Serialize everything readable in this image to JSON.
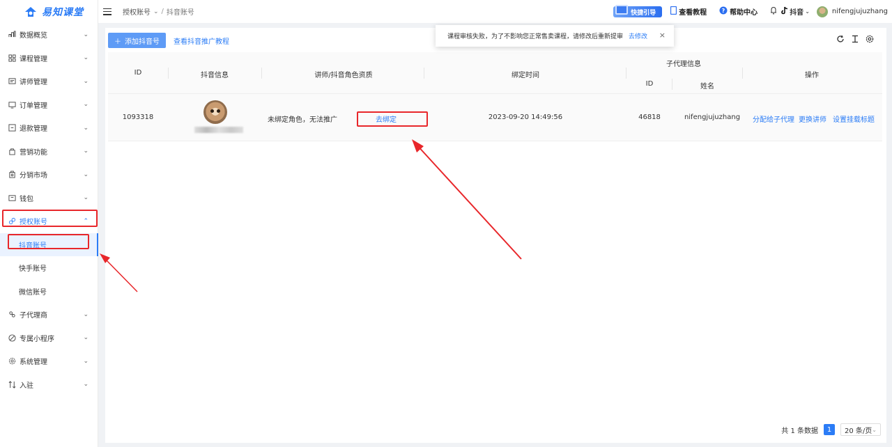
{
  "app": {
    "logo_text": "易知课堂"
  },
  "header": {
    "breadcrumb": {
      "parent": "授权账号",
      "separator": "/",
      "current": "抖音账号"
    },
    "quick_guide": "快捷引导",
    "tutorial": "查看教程",
    "help_center": "帮助中心",
    "platform": "抖音",
    "username": "nifengjujuzhang"
  },
  "sidebar": {
    "items": [
      {
        "label": "数据概览",
        "icon": "dashboard-icon"
      },
      {
        "label": "课程管理",
        "icon": "grid-icon"
      },
      {
        "label": "讲师管理",
        "icon": "teacher-icon"
      },
      {
        "label": "订单管理",
        "icon": "order-icon"
      },
      {
        "label": "退款管理",
        "icon": "refund-icon"
      },
      {
        "label": "营销功能",
        "icon": "marketing-icon"
      },
      {
        "label": "分销市场",
        "icon": "market-icon"
      },
      {
        "label": "钱包",
        "icon": "wallet-icon"
      },
      {
        "label": "授权账号",
        "icon": "link-icon"
      },
      {
        "label": "子代理商",
        "icon": "agent-icon"
      },
      {
        "label": "专属小程序",
        "icon": "miniapp-icon"
      },
      {
        "label": "系统管理",
        "icon": "settings-icon"
      },
      {
        "label": "入驻",
        "icon": "join-icon"
      }
    ],
    "sub_items": [
      {
        "label": "抖音账号"
      },
      {
        "label": "快手账号"
      },
      {
        "label": "微信账号"
      }
    ]
  },
  "toolbar": {
    "add_button": "添加抖音号",
    "tutorial_link": "查看抖音推广教程"
  },
  "notice": {
    "message": "课程审核失败，为了不影响您正常售卖课程，请修改后重新提审",
    "action": "去修改",
    "close": "×"
  },
  "table": {
    "headers": {
      "id": "ID",
      "douyin_info": "抖音信息",
      "qualification": "讲师/抖音角色资质",
      "bind_time": "绑定时间",
      "sub_agent": "子代理信息",
      "sub_agent_id": "ID",
      "sub_agent_name": "姓名",
      "actions": "操作"
    },
    "rows": [
      {
        "id": "1093318",
        "qualification_text": "未绑定角色，无法推广",
        "bind_action": "去绑定",
        "bind_time": "2023-09-20 14:49:56",
        "sub_agent_id": "46818",
        "sub_agent_name": "nifengjujuzhang",
        "actions": [
          "分配给子代理",
          "更换讲师",
          "设置挂载标题"
        ]
      }
    ]
  },
  "pagination": {
    "total": "共 1 条数据",
    "current_page": "1",
    "page_size": "20 条/页"
  },
  "colors": {
    "accent": "#2b7cf6",
    "annotation": "#e8262a"
  }
}
